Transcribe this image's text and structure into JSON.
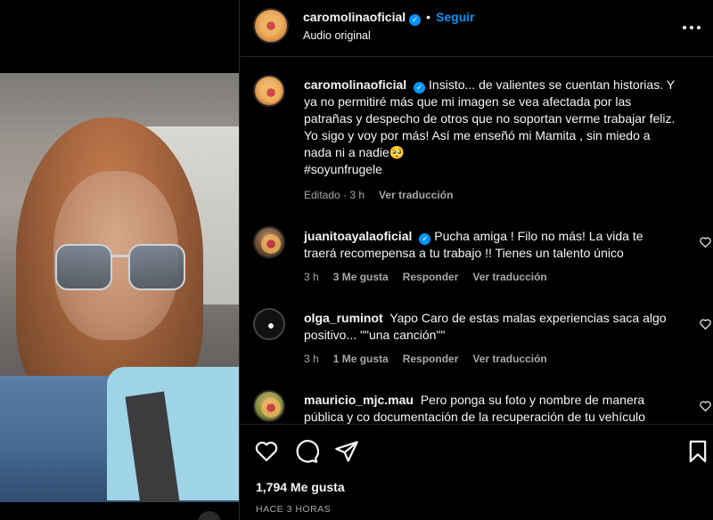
{
  "header": {
    "username": "caromolinaoficial",
    "verified_mark": "✓",
    "separator": "•",
    "follow_label": "Seguir",
    "subtitle": "Audio original",
    "more_icon": "more-horizontal-icon"
  },
  "caption": {
    "username": "caromolinaoficial",
    "text": "Insisto... de valientes se cuentan historias. Y ya no permitiré más que mi imagen se vea afectada por las patrañas y despecho de otros que no soportan verme trabajar feliz. Yo sigo y voy por más! Así me enseñó mi Mamita , sin miedo a nada ni a nadie🥺",
    "hashtag": "#soyunfrugele",
    "edited": "Editado · 3 h",
    "translate": "Ver traducción"
  },
  "comments": [
    {
      "username": "juanitoayalaoficial",
      "verified": true,
      "text": "Pucha amiga ! Filo no más! La vida te traerá recomepensa a tu trabajo !! Tienes un talento único",
      "time": "3 h",
      "likes": "3 Me gusta",
      "reply": "Responder",
      "translate": "Ver traducción"
    },
    {
      "username": "olga_ruminot",
      "verified": false,
      "text": "Yapo Caro de estas malas experiencias saca algo positivo... \"\"una canción\"\"",
      "time": "3 h",
      "likes": "1 Me gusta",
      "reply": "Responder",
      "translate": "Ver traducción"
    },
    {
      "username": "mauricio_mjc.mau",
      "verified": false,
      "text": "Pero ponga su foto y nombre de manera pública y co documentación de la recuperación de tu vehículo"
    }
  ],
  "actions": {
    "likes_count": "1,794 Me gusta",
    "posted": "HACE 3 HORAS",
    "icons": [
      "heart-icon",
      "comment-icon",
      "share-icon",
      "bookmark-icon"
    ]
  },
  "colors": {
    "background": "#000000",
    "text": "#f5f5f5",
    "muted": "#a8a8a8",
    "accent": "#0095f6",
    "divider": "#262626"
  }
}
